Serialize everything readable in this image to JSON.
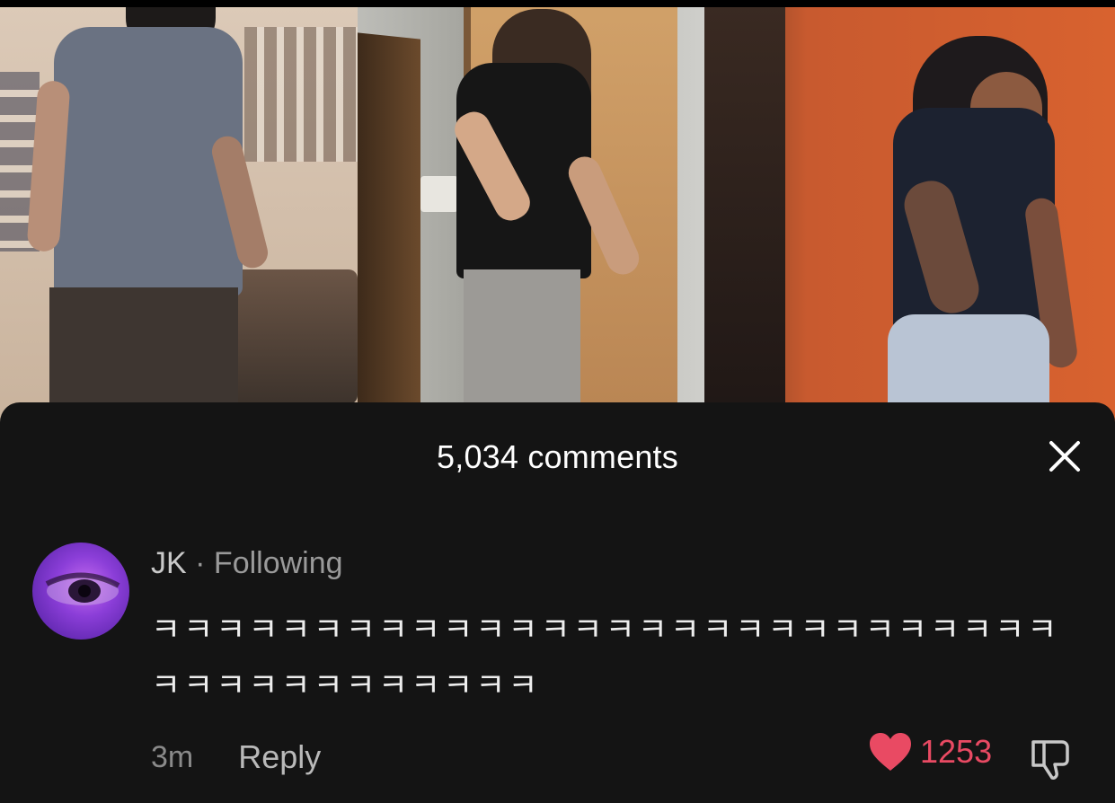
{
  "comments_sheet": {
    "title": "5,034 comments",
    "close_icon": "close-icon"
  },
  "comment": {
    "username": "JK",
    "separator": "·",
    "relationship": "Following",
    "text": "ㅋㅋㅋㅋㅋㅋㅋㅋㅋㅋㅋㅋㅋㅋㅋㅋㅋㅋㅋㅋㅋㅋㅋㅋㅋㅋㅋㅋㅋㅋㅋㅋㅋㅋㅋㅋㅋㅋㅋㅋ",
    "time": "3m",
    "reply_label": "Reply",
    "like_count": "1253",
    "like_icon": "heart-icon",
    "dislike_icon": "thumbs-down-icon",
    "liked": true
  },
  "colors": {
    "sheet_background": "#141414",
    "like_color": "#e94a63",
    "text_primary": "#ffffff",
    "text_secondary": "#9a9a9a"
  }
}
